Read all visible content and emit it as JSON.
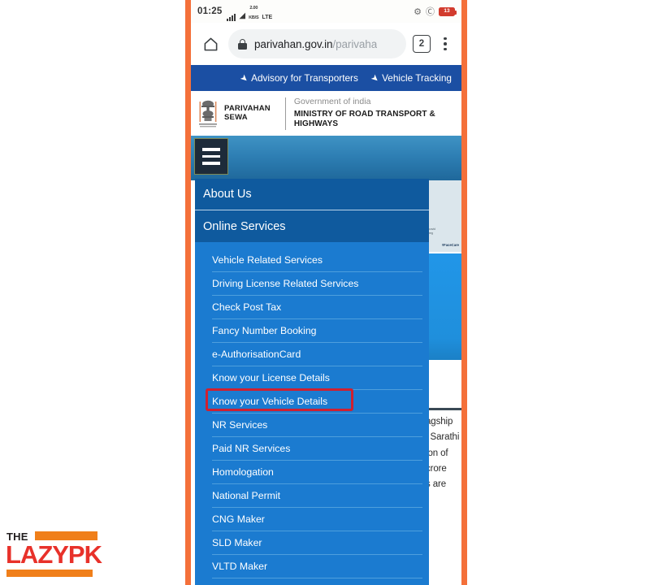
{
  "status_bar": {
    "time": "01:25",
    "signal_icon": "signal-bars-icon",
    "wifi_icon": "wifi-icon",
    "network_label_top": "2.00",
    "network_label_bottom": "KB/S",
    "network_type": "LTE",
    "sync_icon": "sync-icon",
    "vpn_icon": "shield-icon",
    "battery_level": "13"
  },
  "browser": {
    "home_icon": "home-icon",
    "lock_icon": "lock-icon",
    "url_domain": "parivahan.gov.in",
    "url_path": "/parivaha",
    "tab_count": "2",
    "overflow_icon": "three-dot-menu-icon"
  },
  "site_topbar": {
    "links": [
      {
        "label": "Advisory for Transporters",
        "icon": "paper-plane-icon"
      },
      {
        "label": "Vehicle Tracking",
        "icon": "paper-plane-icon"
      }
    ]
  },
  "site_header": {
    "emblem_icon": "ashoka-emblem-icon",
    "brand_line1": "PARIVAHAN",
    "brand_line2": "SEWA",
    "gov_line": "Government of india",
    "ministry_line": "MINISTRY OF ROAD TRANSPORT & HIGHWAYS"
  },
  "banner": {
    "hamburger_icon": "hamburger-menu-icon"
  },
  "page_behind": {
    "card_caption": "covid vaccination\nregistration",
    "card_tag": "#FaceCare",
    "paragraph_lines": [
      "agship",
      "l Sarathi",
      "ion of",
      "crore",
      "s are"
    ]
  },
  "menu": {
    "top_items": [
      {
        "label": "About Us"
      },
      {
        "label": "Online Services"
      }
    ],
    "sub_items": [
      {
        "label": "Vehicle Related Services",
        "highlighted": false
      },
      {
        "label": "Driving License Related Services",
        "highlighted": false
      },
      {
        "label": "Check Post Tax",
        "highlighted": false
      },
      {
        "label": "Fancy Number Booking",
        "highlighted": false
      },
      {
        "label": "e-AuthorisationCard",
        "highlighted": false
      },
      {
        "label": "Know your License Details",
        "highlighted": false
      },
      {
        "label": "Know your Vehicle Details",
        "highlighted": true
      },
      {
        "label": "NR Services",
        "highlighted": false
      },
      {
        "label": "Paid NR Services",
        "highlighted": false
      },
      {
        "label": "Homologation",
        "highlighted": false
      },
      {
        "label": "National Permit",
        "highlighted": false
      },
      {
        "label": "CNG Maker",
        "highlighted": false
      },
      {
        "label": "SLD Maker",
        "highlighted": false
      },
      {
        "label": "VLTD Maker",
        "highlighted": false
      }
    ],
    "highlight_color": "#cf2030"
  },
  "watermark": {
    "the_text": "THE",
    "name_text": "LAZYPK",
    "bar_color": "#f07f1a",
    "name_color": "#e8312a"
  },
  "colors": {
    "phone_border": "#f4703a",
    "site_topbar_blue": "#1b4fa3",
    "menu_blue": "#1b7bd0",
    "menu_header_blue": "#0f5a9e"
  }
}
